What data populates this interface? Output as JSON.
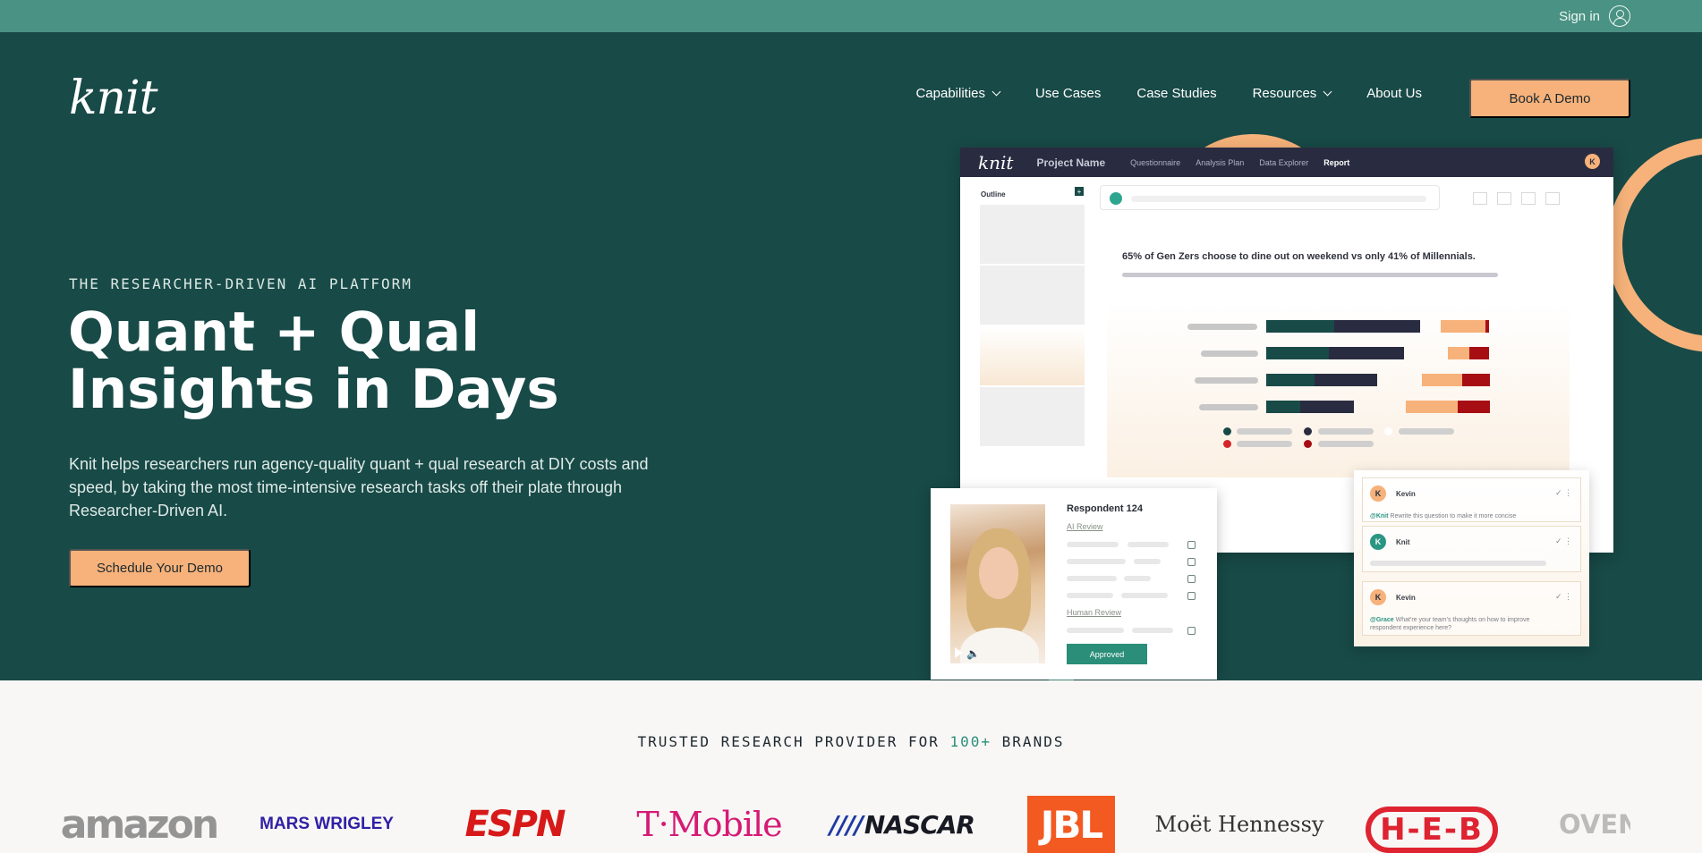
{
  "topbar": {
    "signin_label": "Sign in",
    "icon": "user-circle-icon"
  },
  "header": {
    "logo": "knit",
    "nav": [
      {
        "label": "Capabilities",
        "dropdown": true
      },
      {
        "label": "Use Cases",
        "dropdown": false
      },
      {
        "label": "Case Studies",
        "dropdown": false
      },
      {
        "label": "Resources",
        "dropdown": true
      },
      {
        "label": "About Us",
        "dropdown": false
      }
    ],
    "cta": "Book A Demo"
  },
  "hero": {
    "eyebrow": "THE RESEARCHER-DRIVEN AI PLATFORM",
    "title_line_1": "Quant + Qual",
    "title_line_2": "Insights in Days",
    "description": "Knit helps researchers run agency-quality quant + qual research at DIY costs and speed, by taking the most time-intensive research tasks off their plate through Researcher-Driven AI.",
    "cta": "Schedule Your Demo"
  },
  "product_mockup": {
    "app_logo": "knit",
    "project_name": "Project Name",
    "tabs": [
      "Questionnaire",
      "Analysis Plan",
      "Data Explorer",
      "Report"
    ],
    "avatar": "K",
    "outline_label": "Outline",
    "outline_add": "+",
    "report_headline": "65% of Gen Zers choose to dine out on weekend vs only 41% of Millennials.",
    "respondent": {
      "title": "Respondent 124",
      "ai_review": "AI Review",
      "human_review": "Human Review",
      "status": "Approved"
    },
    "comments": [
      {
        "avatar": "K",
        "name": "Kevin",
        "mention": "@Knit",
        "text": "Rewrite this question to make it more concise"
      },
      {
        "avatar": "K",
        "name": "Knit",
        "mention": "",
        "text": ""
      },
      {
        "avatar": "K",
        "name": "Kevin",
        "mention": "@Grace",
        "text": "What're your team's thoughts on how to improve respondent experience here?"
      }
    ],
    "comment_actions": "✓ ⋮",
    "colors": {
      "dark_teal": "#184a47",
      "navy": "#292c40",
      "peach": "#f6b27a",
      "red": "#a70e14"
    }
  },
  "trusted": {
    "prefix": "TRUSTED RESEARCH PROVIDER FOR ",
    "count": "100+",
    "suffix": " BRANDS",
    "brands": [
      "amazon",
      "MARS WRIGLEY",
      "ESPN",
      "T·Mobile",
      "NASCAR",
      "JBL",
      "Moët Hennessy",
      "H-E-B",
      "OVEN"
    ]
  },
  "colors": {
    "hero_bg": "#184a47",
    "topbar_bg": "#4a9283",
    "cta": "#f6b27a",
    "light_bg": "#f8f7f5"
  }
}
